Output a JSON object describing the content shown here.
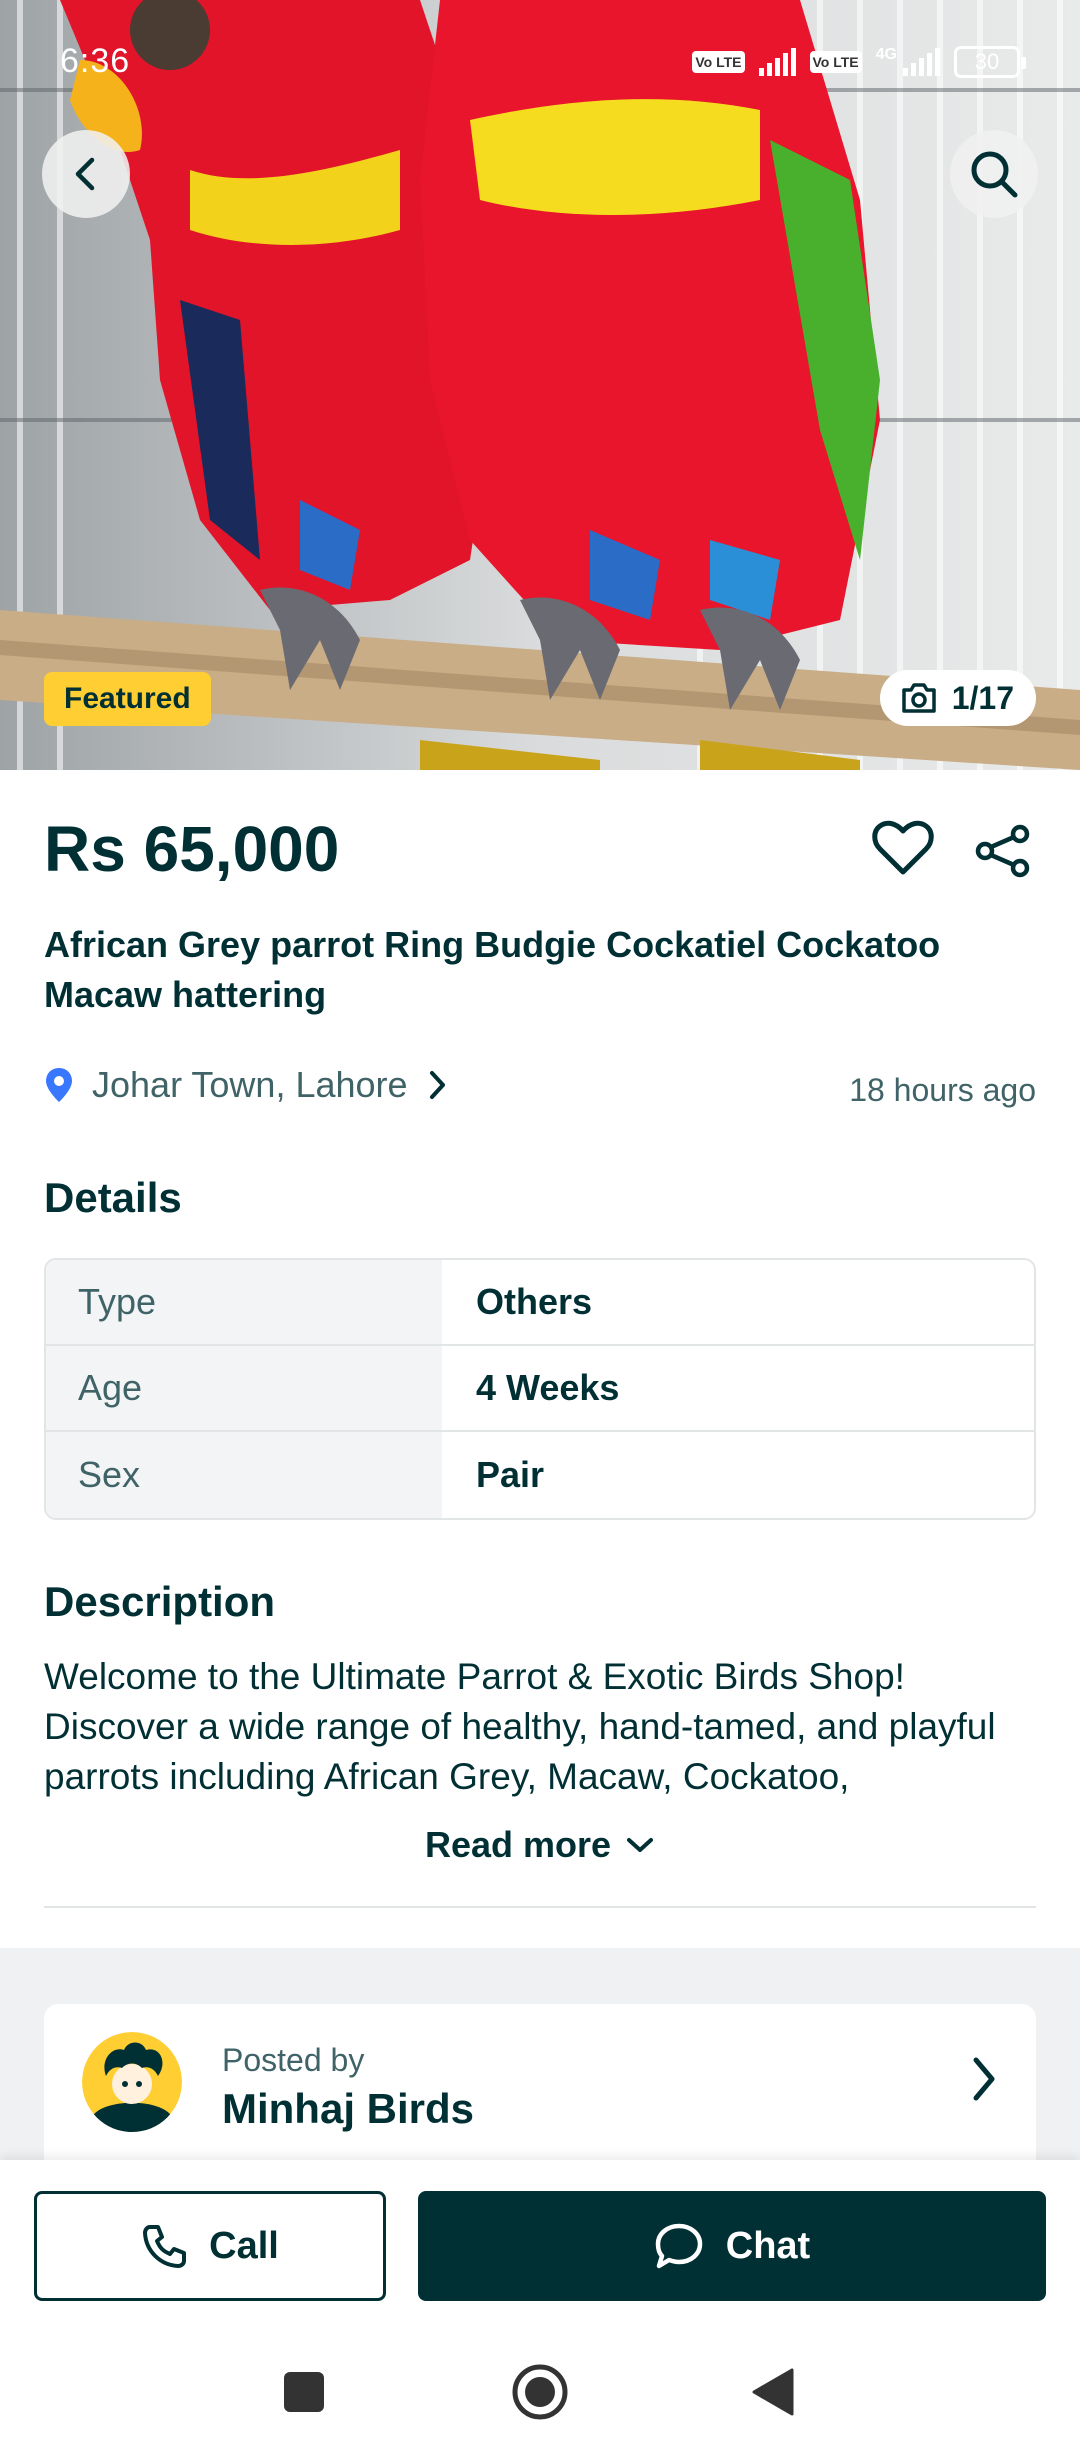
{
  "status_bar": {
    "time": "6:36",
    "volte1": "Vo LTE",
    "volte2": "Vo LTE",
    "network": "4G",
    "battery": "30"
  },
  "gallery": {
    "featured_label": "Featured",
    "photo_counter": "1/17"
  },
  "listing": {
    "price": "Rs 65,000",
    "title": "African Grey parrot Ring  Budgie Cockatiel Cockatoo Macaw hattering",
    "location": "Johar Town, Lahore",
    "posted_ago": "18 hours ago"
  },
  "details": {
    "heading": "Details",
    "rows": [
      {
        "key": "Type",
        "value": "Others"
      },
      {
        "key": "Age",
        "value": "4 Weeks"
      },
      {
        "key": "Sex",
        "value": "Pair"
      }
    ]
  },
  "description": {
    "heading": "Description",
    "text": "Welcome to the Ultimate Parrot & Exotic Birds Shop! Discover a wide range of healthy, hand-tamed, and playful parrots including African Grey, Macaw, Cockatoo,",
    "read_more": "Read more"
  },
  "seller": {
    "posted_by_label": "Posted by",
    "name": "Minhaj Birds"
  },
  "actions": {
    "call_label": "Call",
    "chat_label": "Chat"
  },
  "colors": {
    "primary": "#002f34",
    "secondary_text": "#406367",
    "featured_badge": "#ffce32",
    "location_pin": "#3a77ff"
  }
}
